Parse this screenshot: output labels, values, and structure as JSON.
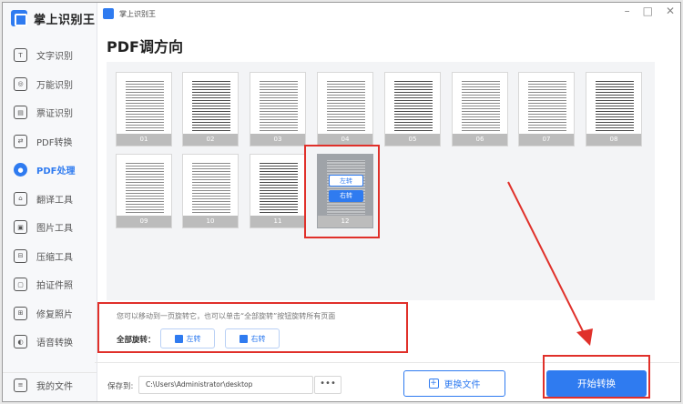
{
  "app": {
    "name": "掌上识别王",
    "window_title": "掌上识别王"
  },
  "window_controls": {
    "minimize": "–",
    "maximize": "□",
    "close": "✕"
  },
  "sidebar": {
    "items": [
      {
        "label": "文字识别",
        "icon": "text-recognition-icon",
        "glyph": "T"
      },
      {
        "label": "万能识别",
        "icon": "universal-recognition-icon",
        "glyph": "◎"
      },
      {
        "label": "票证识别",
        "icon": "ticket-recognition-icon",
        "glyph": "▤"
      },
      {
        "label": "PDF转换",
        "icon": "pdf-convert-icon",
        "glyph": "⇄"
      },
      {
        "label": "PDF处理",
        "icon": "pdf-process-icon",
        "glyph": "●",
        "active": true
      },
      {
        "label": "翻译工具",
        "icon": "translate-icon",
        "glyph": "⌂"
      },
      {
        "label": "图片工具",
        "icon": "image-tool-icon",
        "glyph": "▣"
      },
      {
        "label": "压缩工具",
        "icon": "compress-icon",
        "glyph": "⊟"
      },
      {
        "label": "拍证件照",
        "icon": "id-photo-icon",
        "glyph": "▢"
      },
      {
        "label": "修复照片",
        "icon": "repair-photo-icon",
        "glyph": "⊞"
      },
      {
        "label": "语音转换",
        "icon": "voice-convert-icon",
        "glyph": "◐"
      }
    ],
    "bottom": {
      "label": "我的文件",
      "icon": "my-files-icon",
      "glyph": "≡"
    }
  },
  "page": {
    "title": "PDF调方向"
  },
  "pages": [
    {
      "num": "01"
    },
    {
      "num": "02"
    },
    {
      "num": "03"
    },
    {
      "num": "04"
    },
    {
      "num": "05"
    },
    {
      "num": "06"
    },
    {
      "num": "07"
    },
    {
      "num": "08"
    },
    {
      "num": "09"
    },
    {
      "num": "10"
    },
    {
      "num": "11"
    },
    {
      "num": "12",
      "selected": true
    }
  ],
  "hover_actions": {
    "left": "左转",
    "right": "右转"
  },
  "info": {
    "hint": "您可以移动到一页旋转它，也可以单击“全部旋转”按钮旋转所有页面",
    "all_label": "全部旋转：",
    "left_button": "左转",
    "right_button": "右转"
  },
  "bottom_bar": {
    "save_label": "保存到:",
    "save_path": "C:\\Users\\Administrator\\desktop",
    "more": "•••",
    "change_file": "更换文件",
    "start": "开始转换"
  },
  "colors": {
    "accent": "#2f7bf0",
    "highlight": "#e0302a"
  }
}
